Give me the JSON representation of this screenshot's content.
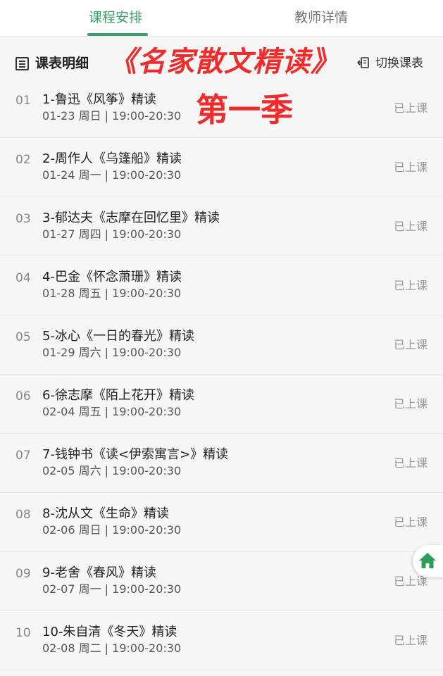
{
  "tabs": [
    {
      "label": "课程安排",
      "active": true
    },
    {
      "label": "教师详情",
      "active": false
    }
  ],
  "toolbar": {
    "detail_label": "课表明细",
    "promo_title": "《名家散文精读》",
    "switch_label": "切换课表"
  },
  "season_label": "第一季",
  "lessons": [
    {
      "index": "01",
      "title": "1-鲁迅《风筝》精读",
      "time": "01-23 周日 | 19:00-20:30",
      "status": "已上课"
    },
    {
      "index": "02",
      "title": "2-周作人《乌篷船》精读",
      "time": "01-24 周一 | 19:00-20:30",
      "status": "已上课"
    },
    {
      "index": "03",
      "title": "3-郁达夫《志摩在回忆里》精读",
      "time": "01-27 周四 | 19:00-20:30",
      "status": "已上课"
    },
    {
      "index": "04",
      "title": "4-巴金《怀念萧珊》精读",
      "time": "01-28 周五 | 19:00-20:30",
      "status": "已上课"
    },
    {
      "index": "05",
      "title": "5-冰心《一日的春光》精读",
      "time": "01-29 周六 | 19:00-20:30",
      "status": "已上课"
    },
    {
      "index": "06",
      "title": "6-徐志摩《陌上花开》精读",
      "time": "02-04 周五 | 19:00-20:30",
      "status": "已上课"
    },
    {
      "index": "07",
      "title": "7-钱钟书《读<伊索寓言>》精读",
      "time": "02-05 周六 | 19:00-20:30",
      "status": "已上课"
    },
    {
      "index": "08",
      "title": "8-沈从文《生命》精读",
      "time": "02-06 周日 | 19:00-20:30",
      "status": "已上课"
    },
    {
      "index": "09",
      "title": "9-老舍《春风》精读",
      "time": "02-07 周一 | 19:00-20:30",
      "status": "已上课"
    },
    {
      "index": "10",
      "title": "10-朱自清《冬天》精读",
      "time": "02-08 周二 | 19:00-20:30",
      "status": "已上课"
    }
  ],
  "icons": {
    "detail": "table-list-icon",
    "switch": "switch-schedule-icon",
    "home": "home-icon"
  },
  "colors": {
    "accent_green": "#3aa169",
    "promo_red": "#ee2c2c",
    "home_green": "#2f9e5b"
  }
}
